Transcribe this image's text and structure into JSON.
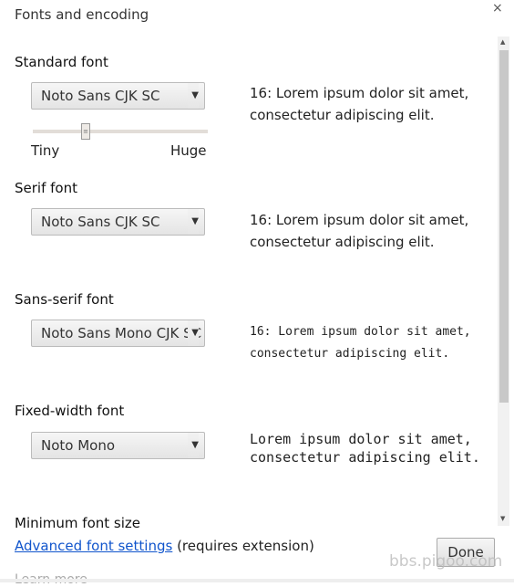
{
  "dialog": {
    "title": "Fonts and encoding",
    "close_icon": "×"
  },
  "sections": [
    {
      "label": "Standard font",
      "selected": "Noto Sans CJK SC",
      "sample": [
        "16: Lorem ipsum dolor sit amet,",
        "consectetur adipiscing elit."
      ]
    },
    {
      "label": "Serif font",
      "selected": "Noto Sans CJK SC",
      "sample": [
        "16: Lorem ipsum dolor sit amet,",
        "consectetur adipiscing elit."
      ]
    },
    {
      "label": "Sans-serif font",
      "selected": "Noto Sans Mono CJK SC",
      "sample": [
        "16: Lorem ipsum dolor sit amet,",
        "consectetur adipiscing elit."
      ]
    },
    {
      "label": "Fixed-width font",
      "selected": "Noto Mono",
      "sample": [
        "Lorem ipsum dolor sit amet,",
        "consectetur adipiscing elit."
      ]
    },
    {
      "label": "Minimum font size"
    }
  ],
  "size_slider": {
    "min_label": "Tiny",
    "max_label": "Huge",
    "value_fraction": 0.3
  },
  "footer": {
    "link": "Advanced font settings",
    "suffix": " (requires extension)",
    "done": "Done"
  },
  "watermark": "bbs.pigoo.com",
  "background_text": "Learn more"
}
